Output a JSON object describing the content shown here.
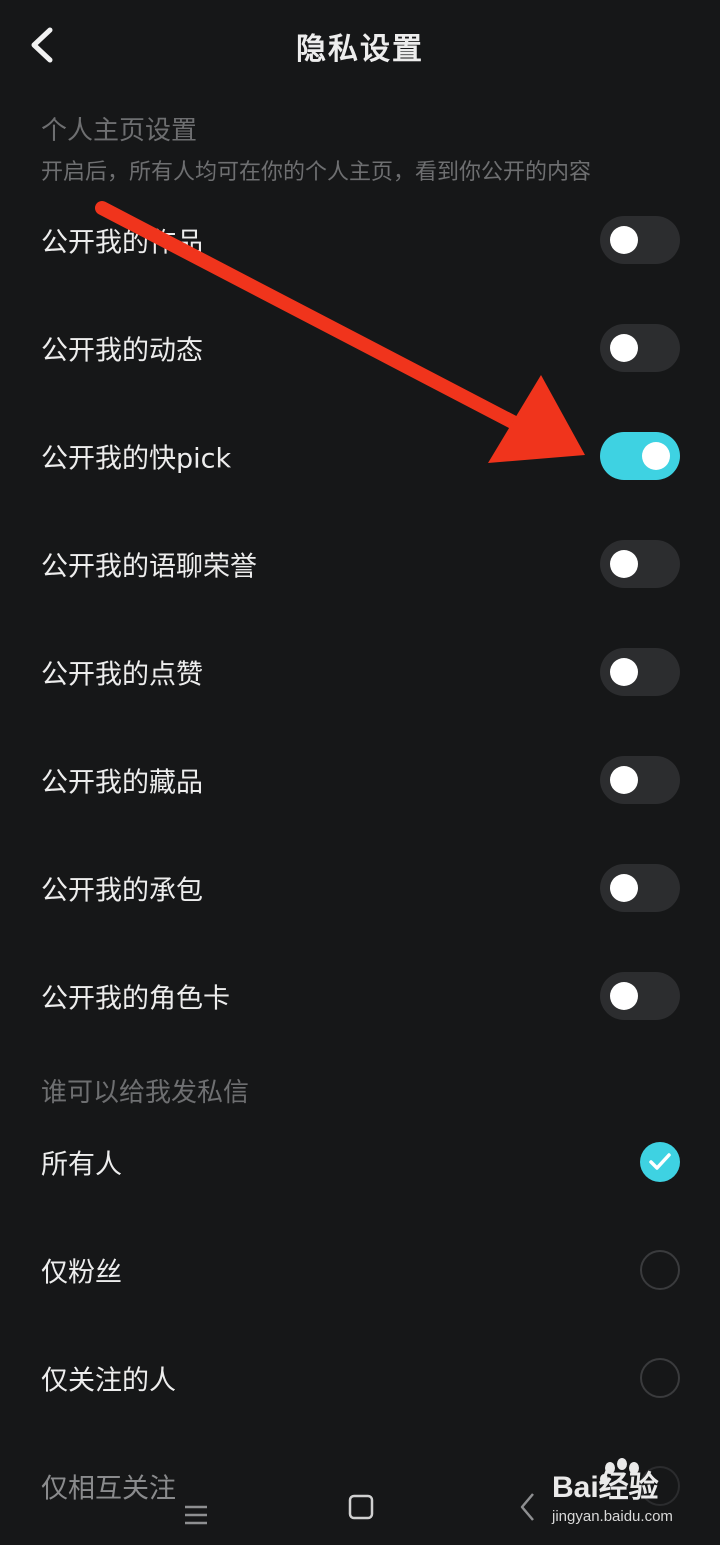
{
  "header": {
    "title": "隐私设置",
    "back_icon": "chevron-left-icon"
  },
  "profile_section": {
    "title": "个人主页设置",
    "description": "开启后，所有人均可在你的个人主页，看到你公开的内容",
    "items": [
      {
        "label": "公开我的作品",
        "on": false
      },
      {
        "label": "公开我的动态",
        "on": false
      },
      {
        "label": "公开我的快pick",
        "on": true
      },
      {
        "label": "公开我的语聊荣誉",
        "on": false
      },
      {
        "label": "公开我的点赞",
        "on": false
      },
      {
        "label": "公开我的藏品",
        "on": false
      },
      {
        "label": "公开我的承包",
        "on": false
      },
      {
        "label": "公开我的角色卡",
        "on": false
      }
    ]
  },
  "message_section": {
    "title": "谁可以给我发私信",
    "options": [
      {
        "label": "所有人",
        "selected": true
      },
      {
        "label": "仅粉丝",
        "selected": false
      },
      {
        "label": "仅关注的人",
        "selected": false
      },
      {
        "label": "仅相互关注",
        "selected": false
      }
    ]
  },
  "colors": {
    "background": "#161718",
    "accent": "#3ED2E2",
    "toggle_off": "#2C2D2F",
    "annotation_arrow": "#F0341C",
    "muted_text": "#6E6F71"
  },
  "navbar": {
    "icons": [
      "menu-icon",
      "home-square-icon",
      "back-triangle-icon"
    ]
  },
  "watermark": {
    "brand": "Bai经验",
    "url": "jingyan.baidu.com"
  }
}
